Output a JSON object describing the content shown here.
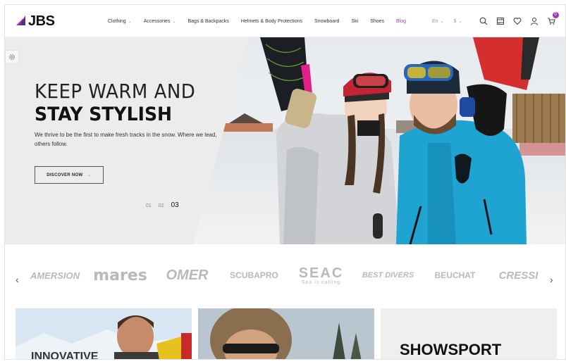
{
  "header": {
    "logo_text": "JBS",
    "nav": [
      {
        "label": "Clothing",
        "has_dropdown": true
      },
      {
        "label": "Accessories",
        "has_dropdown": true
      },
      {
        "label": "Bags & Backpacks",
        "has_dropdown": false
      },
      {
        "label": "Helmets & Body Protections",
        "has_dropdown": false
      },
      {
        "label": "Snowboard",
        "has_dropdown": false
      },
      {
        "label": "Ski",
        "has_dropdown": false
      },
      {
        "label": "Shoes",
        "has_dropdown": false
      },
      {
        "label": "Blog",
        "has_dropdown": false,
        "active": true
      }
    ],
    "language": "En",
    "currency": "$",
    "cart_count": "0",
    "icons": [
      "search-icon",
      "compare-icon",
      "heart-icon",
      "user-icon",
      "cart-icon"
    ]
  },
  "hero": {
    "title_line1": "KEEP WARM AND",
    "title_line2": "STAY STYLISH",
    "description": "We thrive to be the first to make fresh tracks in the snow. Where we lead, others follow.",
    "button_label": "DISCOVER NOW",
    "slides": [
      "01",
      "02",
      "03"
    ],
    "active_slide": "03"
  },
  "brands": [
    "AMERSION",
    "mares",
    "OMER",
    "SCUBAPRO",
    "SEAC",
    "Sea is calling",
    "BEST DIVERS",
    "BEUCHAT",
    "CRESSI"
  ],
  "cards": [
    {
      "title": "INNOVATIVE"
    },
    {
      "title": ""
    },
    {
      "title": "SHOWSPORT"
    }
  ],
  "colors": {
    "accent": "#9b3fb3",
    "logo_dark": "#5a2d82",
    "hero_bg": "#ececec",
    "brand_gray": "#b9b9b9"
  }
}
